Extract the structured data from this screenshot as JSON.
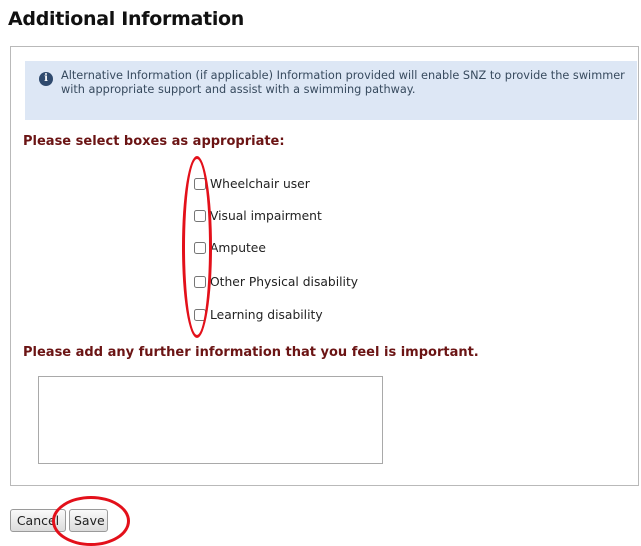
{
  "page": {
    "title": "Additional Information"
  },
  "info": {
    "icon": "info-circle-icon",
    "text": "Alternative Information (if applicable) Information provided will enable SNZ to provide the swimmer with appropriate support and assist with a swimming pathway."
  },
  "checkboxes": {
    "heading": "Please select boxes as appropriate:",
    "items": [
      {
        "label": "Wheelchair user",
        "checked": false
      },
      {
        "label": "Visual impairment",
        "checked": false
      },
      {
        "label": "Amputee",
        "checked": false
      },
      {
        "label": "Other Physical disability",
        "checked": false
      },
      {
        "label": "Learning disability",
        "checked": false
      }
    ]
  },
  "further": {
    "heading": "Please add any further information that you feel is important.",
    "value": ""
  },
  "actions": {
    "cancel_label": "Cancel",
    "save_label": "Save"
  },
  "colors": {
    "heading": "#6b1414",
    "info_bg": "#dde7f5",
    "annotation": "#e3101a"
  }
}
